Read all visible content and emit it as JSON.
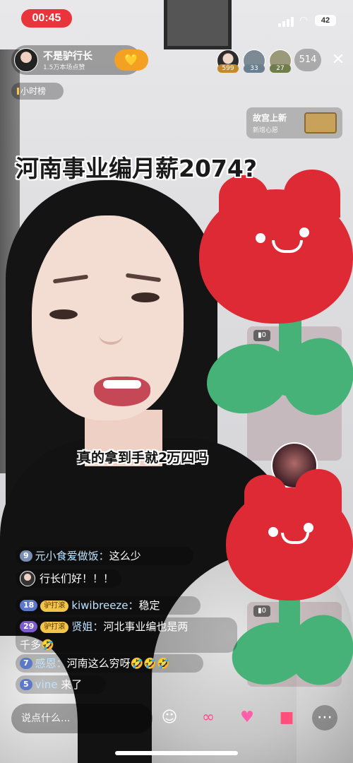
{
  "status_bar": {
    "time": "00:45",
    "battery": "42"
  },
  "streamer": {
    "name": "不是驴行长",
    "subtitle": "1.5万本场点赞",
    "follow_icon": "heart-icon"
  },
  "rank_chip": {
    "label": "小时榜"
  },
  "viewers": [
    {
      "badge": "599"
    },
    {
      "badge": "33"
    },
    {
      "badge": "27"
    }
  ],
  "viewer_count": "514",
  "promo": {
    "title": "故宫上新",
    "subtitle": "新增心愿"
  },
  "caption": {
    "headline": "河南事业编月薪2074?",
    "subtitle": "真的拿到手就2万四吗"
  },
  "side_panels": {
    "tag_top": "▮0",
    "tag_bottom": "▮0"
  },
  "chat": [
    {
      "level": "9",
      "user": "元小食爱做饭：",
      "text": "这么少"
    },
    {
      "text": "行长们好！！！"
    },
    {
      "level": "18",
      "fan": "驴打滚",
      "user": "kiwibreeze：",
      "text": "稳定"
    },
    {
      "level": "29",
      "fan": "驴打滚",
      "user": "贤姐：",
      "text": "河北事业编也是两",
      "text_line2": "千多🤣"
    },
    {
      "level": "7",
      "user": "感恩：",
      "text": "河南这么穷呀🤣🤣🤣"
    },
    {
      "level": "5",
      "user": "vine",
      "text": " 来了"
    }
  ],
  "input": {
    "placeholder": "说点什么..."
  },
  "colors": {
    "live_red": "#e8343a",
    "tulip_red": "#de2a34",
    "tulip_green": "#46b277",
    "follow_orange": "#f4a023"
  }
}
